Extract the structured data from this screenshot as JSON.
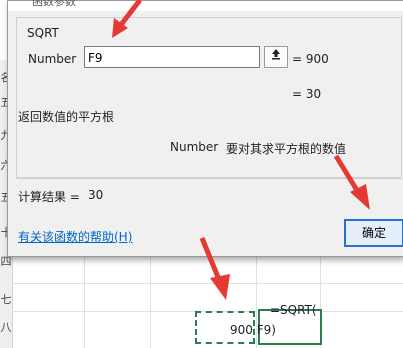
{
  "dialog": {
    "title": "函数参数",
    "function_name": "SQRT",
    "arg_label": "Number",
    "arg_value": "F9",
    "ref_icon": "collapse-ref-icon",
    "arg_result": "= 900",
    "formula_result": "= 30",
    "description": "返回数值的平方根",
    "arg_desc_name": "Number",
    "arg_desc_text": "要对其求平方根的数值",
    "calc_result_label": "计算结果 =",
    "calc_result_value": "30",
    "help_link": "有关该函数的帮助(H)",
    "ok_label": "确定"
  },
  "sheet": {
    "row_headers": [
      "名",
      "五",
      "九",
      "六",
      "五",
      "十",
      "四",
      "七",
      "八"
    ],
    "formula_line1": "=SQRT(",
    "formula_line2": "900 F9)"
  },
  "colors": {
    "arrow": "#e53935",
    "accent": "#2b6fcf",
    "copy_border": "#2e7d4f"
  }
}
